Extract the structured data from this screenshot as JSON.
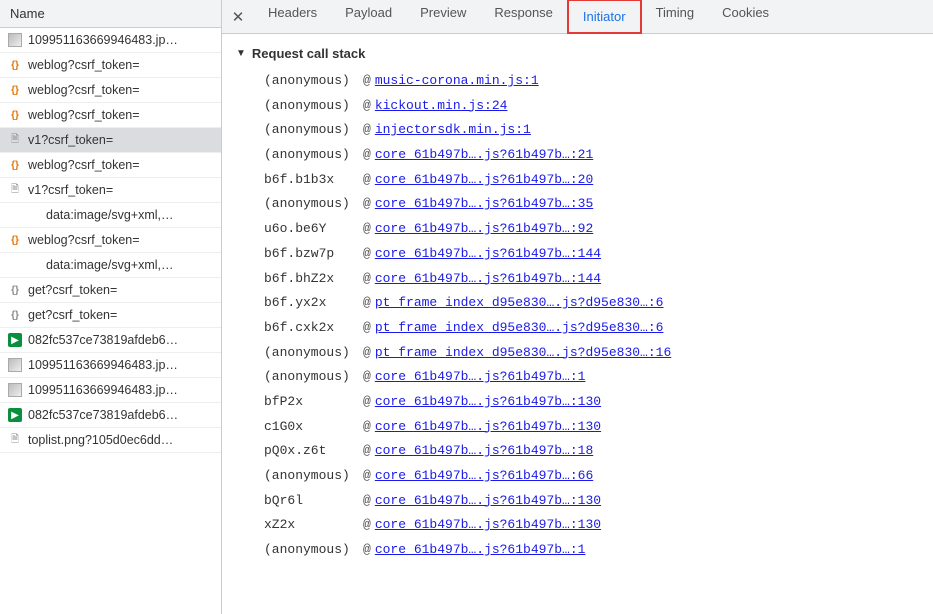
{
  "sidebar": {
    "header": "Name",
    "rows": [
      {
        "icon": "img",
        "label": "109951163669946483.jp…"
      },
      {
        "icon": "braces-o",
        "label": "weblog?csrf_token="
      },
      {
        "icon": "braces-o",
        "label": "weblog?csrf_token="
      },
      {
        "icon": "braces-o",
        "label": "weblog?csrf_token="
      },
      {
        "icon": "doc",
        "label": "v1?csrf_token=",
        "selected": true
      },
      {
        "icon": "braces-o",
        "label": "weblog?csrf_token="
      },
      {
        "icon": "doc",
        "label": "v1?csrf_token="
      },
      {
        "icon": "none",
        "label": "data:image/svg+xml,…",
        "indent": true
      },
      {
        "icon": "braces-o",
        "label": "weblog?csrf_token="
      },
      {
        "icon": "none",
        "label": "data:image/svg+xml,…",
        "indent": true
      },
      {
        "icon": "braces-g",
        "label": "get?csrf_token="
      },
      {
        "icon": "braces-g",
        "label": "get?csrf_token="
      },
      {
        "icon": "media",
        "label": "082fc537ce73819afdeb6…"
      },
      {
        "icon": "img",
        "label": "109951163669946483.jp…"
      },
      {
        "icon": "img",
        "label": "109951163669946483.jp…"
      },
      {
        "icon": "media",
        "label": "082fc537ce73819afdeb6…"
      },
      {
        "icon": "doc",
        "label": "toplist.png?105d0ec6dd…"
      }
    ]
  },
  "tabs": {
    "items": [
      "Headers",
      "Payload",
      "Preview",
      "Response",
      "Initiator",
      "Timing",
      "Cookies"
    ],
    "active": "Initiator",
    "highlighted": "Initiator"
  },
  "section_title": "Request call stack",
  "stack": [
    {
      "func": "(anonymous)",
      "link": "music-corona.min.js:1"
    },
    {
      "func": "(anonymous)",
      "link": "kickout.min.js:24"
    },
    {
      "func": "(anonymous)",
      "link": "injectorsdk.min.js:1"
    },
    {
      "func": "(anonymous)",
      "link": "core_61b497b….js?61b497b…:21"
    },
    {
      "func": "b6f.b1b3x",
      "link": "core_61b497b….js?61b497b…:20"
    },
    {
      "func": "(anonymous)",
      "link": "core_61b497b….js?61b497b…:35"
    },
    {
      "func": "u6o.be6Y",
      "link": "core_61b497b….js?61b497b…:92"
    },
    {
      "func": "b6f.bzw7p",
      "link": "core_61b497b….js?61b497b…:144"
    },
    {
      "func": "b6f.bhZ2x",
      "link": "core_61b497b….js?61b497b…:144"
    },
    {
      "func": "b6f.yx2x",
      "link": "pt_frame_index_d95e830….js?d95e830…:6"
    },
    {
      "func": "b6f.cxk2x",
      "link": "pt_frame_index_d95e830….js?d95e830…:6"
    },
    {
      "func": "(anonymous)",
      "link": "pt_frame_index_d95e830….js?d95e830…:16"
    },
    {
      "func": "(anonymous)",
      "link": "core_61b497b….js?61b497b…:1"
    },
    {
      "func": "bfP2x",
      "link": "core_61b497b….js?61b497b…:130"
    },
    {
      "func": "c1G0x",
      "link": "core_61b497b….js?61b497b…:130"
    },
    {
      "func": "pQ0x.z6t",
      "link": "core_61b497b….js?61b497b…:18"
    },
    {
      "func": "(anonymous)",
      "link": "core_61b497b….js?61b497b…:66"
    },
    {
      "func": "bQr6l",
      "link": "core_61b497b….js?61b497b…:130"
    },
    {
      "func": "xZ2x",
      "link": "core_61b497b….js?61b497b…:130"
    },
    {
      "func": "(anonymous)",
      "link": "core_61b497b….js?61b497b…:1"
    }
  ]
}
